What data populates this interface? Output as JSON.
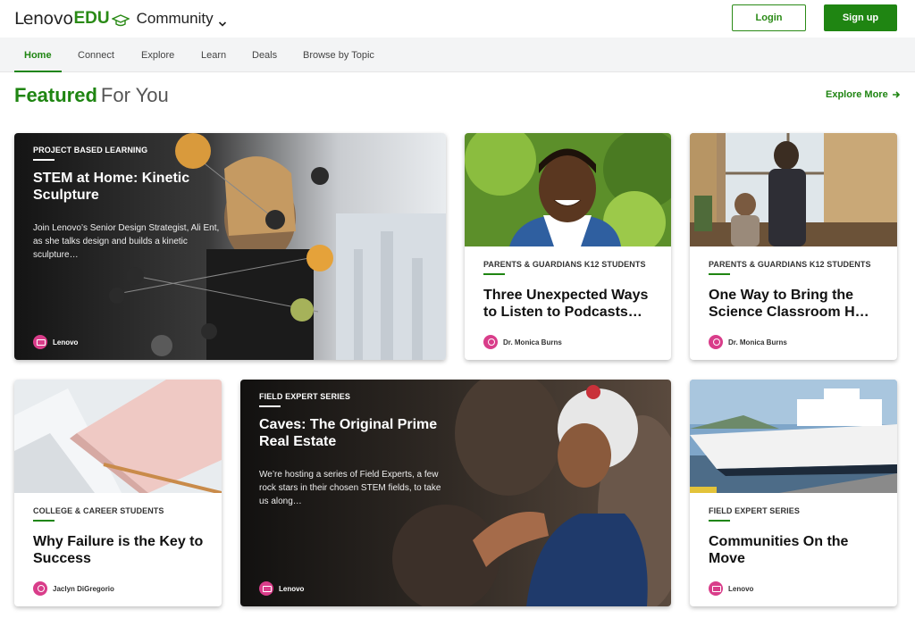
{
  "header": {
    "logo_lenovo": "Lenovo",
    "logo_edu": "EDU",
    "community": "Community",
    "login": "Login",
    "signup": "Sign up"
  },
  "nav": {
    "items": [
      "Home",
      "Connect",
      "Explore",
      "Learn",
      "Deals",
      "Browse by Topic"
    ],
    "active": "Home"
  },
  "section": {
    "title_green": "Featured",
    "title_rest": "For You",
    "explore_more": "Explore More"
  },
  "cards": [
    {
      "category": "PROJECT BASED LEARNING",
      "title": "STEM at Home: Kinetic Sculpture",
      "description": "Join Lenovo’s Senior Design Strategist, Ali Ent, as she talks design and builds a kinetic sculpture…",
      "author": "Lenovo"
    },
    {
      "category": "PARENTS & GUARDIANS K12 STUDENTS",
      "title": "Three Unexpected Ways to Listen to Podcasts…",
      "author": "Dr. Monica Burns"
    },
    {
      "category": "PARENTS & GUARDIANS K12 STUDENTS",
      "title": "One Way to Bring the Science Classroom H…",
      "author": "Dr. Monica Burns"
    },
    {
      "category": "COLLEGE & CAREER STUDENTS",
      "title": "Why Failure is the Key to Success",
      "author": "Jaclyn DiGregorio"
    },
    {
      "category": "FIELD EXPERT SERIES",
      "title": "Caves: The Original Prime Real Estate",
      "description": "We’re hosting a series of Field Experts, a few rock stars in their chosen STEM fields, to take us along…",
      "author": "Lenovo"
    },
    {
      "category": "FIELD EXPERT SERIES",
      "title": "Communities On the Move",
      "author": "Lenovo"
    }
  ],
  "colors": {
    "brand_green": "#1f8512",
    "avatar_pink": "#d93d8a"
  }
}
